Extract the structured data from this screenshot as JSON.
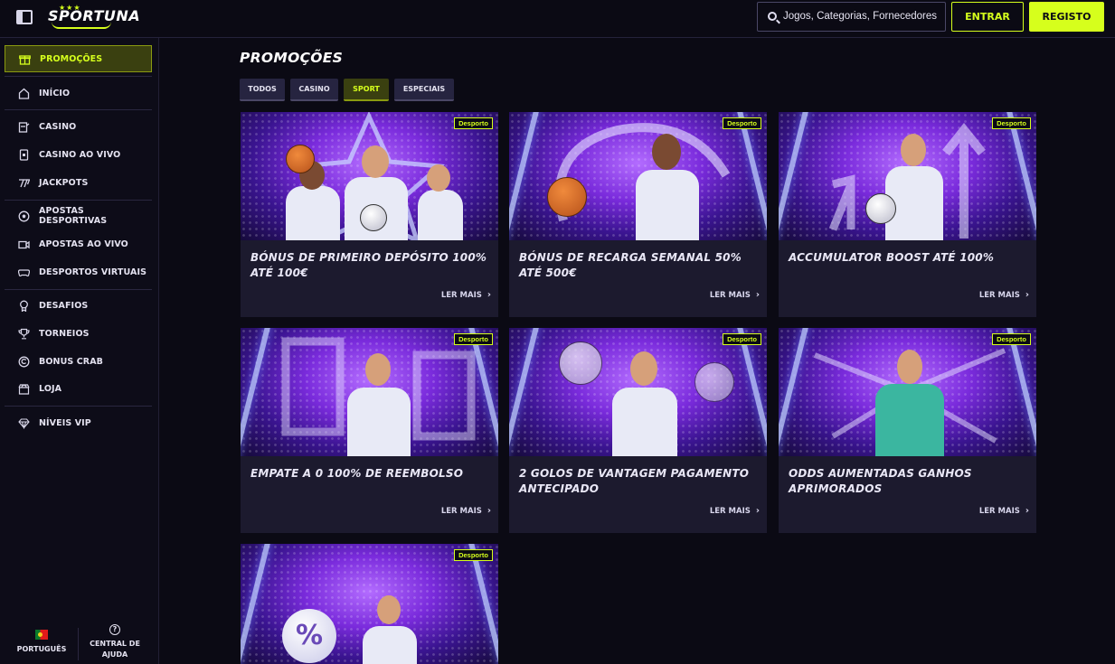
{
  "header": {
    "brand": "SPORTUNA",
    "search_placeholder": "Jogos, Categorias, Fornecedores",
    "login_label": "ENTRAR",
    "register_label": "REGISTO"
  },
  "sidebar": {
    "items": [
      {
        "label": "PROMOÇÕES",
        "icon": "gift-icon",
        "active": true
      },
      {
        "label": "INÍCIO",
        "icon": "home-icon"
      },
      {
        "label": "CASINO",
        "icon": "slot-icon"
      },
      {
        "label": "CASINO AO VIVO",
        "icon": "live-casino-icon"
      },
      {
        "label": "JACKPOTS",
        "icon": "jackpot-icon"
      },
      {
        "label": "APOSTAS DESPORTIVAS",
        "icon": "soccer-ball-icon"
      },
      {
        "label": "APOSTAS AO VIVO",
        "icon": "live-video-icon"
      },
      {
        "label": "DESPORTOS VIRTUAIS",
        "icon": "gamepad-icon"
      },
      {
        "label": "DESAFIOS",
        "icon": "medal-icon"
      },
      {
        "label": "TORNEIOS",
        "icon": "trophy-icon"
      },
      {
        "label": "BONUS CRAB",
        "icon": "bonus-icon"
      },
      {
        "label": "LOJA",
        "icon": "shop-icon"
      },
      {
        "label": "NÍVEIS VIP",
        "icon": "diamond-icon"
      }
    ],
    "language": "PORTUGUÊS",
    "help": "CENTRAL DE AJUDA"
  },
  "main": {
    "title": "PROMOÇÕES",
    "tabs": [
      {
        "label": "TODOS"
      },
      {
        "label": "CASINO"
      },
      {
        "label": "SPORT",
        "active": true
      },
      {
        "label": "ESPECIAIS"
      }
    ],
    "promotions": [
      {
        "tag": "Desporto",
        "title": "BÓNUS DE PRIMEIRO DEPÓSITO 100% ATÉ 100€",
        "cta": "LER MAIS"
      },
      {
        "tag": "Desporto",
        "title": "BÓNUS DE RECARGA SEMANAL 50% ATÉ 500€",
        "cta": "LER MAIS"
      },
      {
        "tag": "Desporto",
        "title": "ACCUMULATOR BOOST ATÉ 100%",
        "cta": "LER MAIS"
      },
      {
        "tag": "Desporto",
        "title": "EMPATE A 0 100% DE REEMBOLSO",
        "cta": "LER MAIS"
      },
      {
        "tag": "Desporto",
        "title": "2 GOLOS DE VANTAGEM PAGAMENTO ANTECIPADO",
        "cta": "LER MAIS"
      },
      {
        "tag": "Desporto",
        "title": "ODDS AUMENTADAS GANHOS APRIMORADOS",
        "cta": "LER MAIS"
      },
      {
        "tag": "Desporto",
        "title": "",
        "cta": ""
      }
    ]
  },
  "colors": {
    "accent": "#d6ff1c",
    "background": "#0b0a14",
    "card": "#1c1a2e"
  }
}
